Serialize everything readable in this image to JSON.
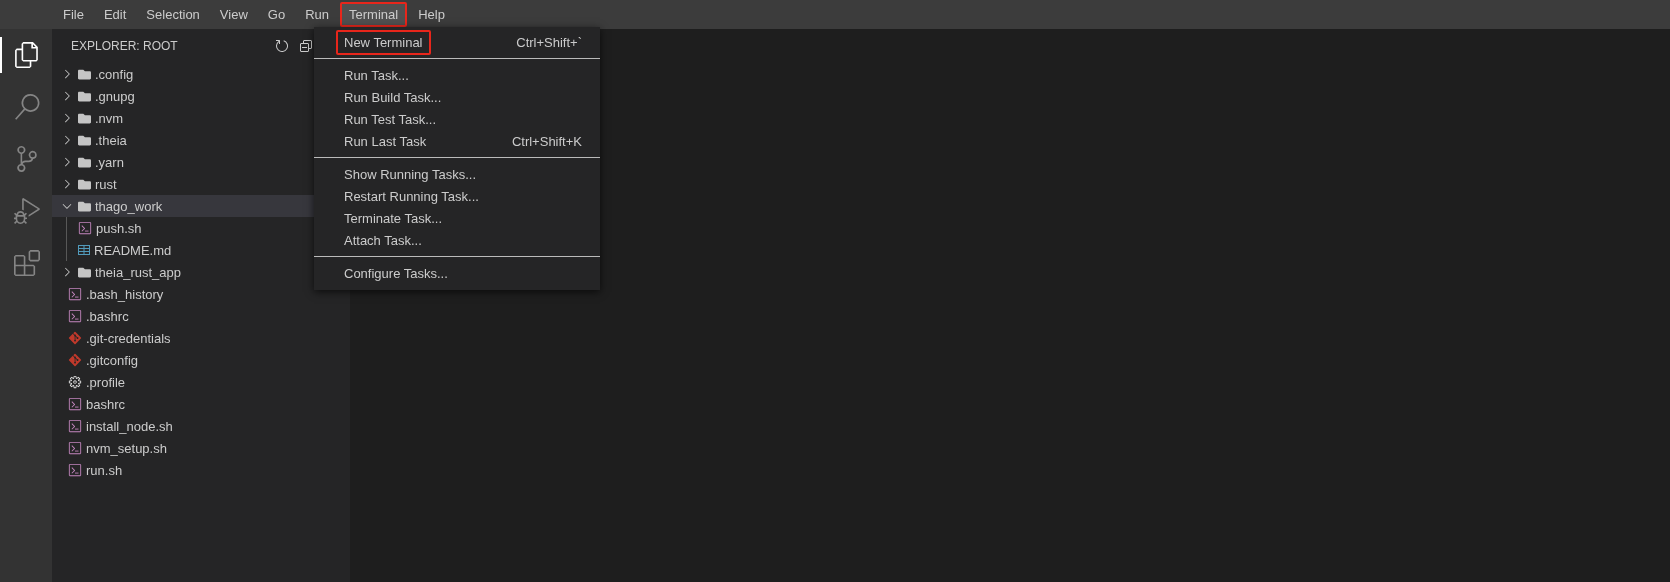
{
  "menu_bar": [
    {
      "label": "File",
      "selected": false,
      "highlighted": false
    },
    {
      "label": "Edit",
      "selected": false,
      "highlighted": false
    },
    {
      "label": "Selection",
      "selected": false,
      "highlighted": false
    },
    {
      "label": "View",
      "selected": false,
      "highlighted": false
    },
    {
      "label": "Go",
      "selected": false,
      "highlighted": false
    },
    {
      "label": "Run",
      "selected": false,
      "highlighted": false
    },
    {
      "label": "Terminal",
      "selected": true,
      "highlighted": true
    },
    {
      "label": "Help",
      "selected": false,
      "highlighted": false
    }
  ],
  "activity_bar": [
    {
      "kind": "files",
      "selected": true
    },
    {
      "kind": "search",
      "selected": false
    },
    {
      "kind": "scm",
      "selected": false
    },
    {
      "kind": "debug",
      "selected": false
    },
    {
      "kind": "extensions",
      "selected": false
    }
  ],
  "sidebar": {
    "title": "EXPLORER: ROOT",
    "items": [
      {
        "kind": "folder",
        "name": ".config",
        "expanded": false,
        "selected": false
      },
      {
        "kind": "folder",
        "name": ".gnupg",
        "expanded": false,
        "selected": false
      },
      {
        "kind": "folder",
        "name": ".nvm",
        "expanded": false,
        "selected": false
      },
      {
        "kind": "folder",
        "name": ".theia",
        "expanded": false,
        "selected": false
      },
      {
        "kind": "folder",
        "name": ".yarn",
        "expanded": false,
        "selected": false
      },
      {
        "kind": "folder",
        "name": "rust",
        "expanded": false,
        "selected": false
      },
      {
        "kind": "folder",
        "name": "thago_work",
        "expanded": true,
        "selected": true,
        "children": [
          {
            "kind": "shell",
            "name": "push.sh",
            "selected": false
          },
          {
            "kind": "markdown",
            "name": "README.md",
            "selected": false
          }
        ]
      },
      {
        "kind": "folder",
        "name": "theia_rust_app",
        "expanded": false,
        "selected": false
      },
      {
        "kind": "shell",
        "name": ".bash_history",
        "selected": false
      },
      {
        "kind": "shell",
        "name": ".bashrc",
        "selected": false
      },
      {
        "kind": "git",
        "name": ".git-credentials",
        "selected": false
      },
      {
        "kind": "git",
        "name": ".gitconfig",
        "selected": false
      },
      {
        "kind": "settings",
        "name": ".profile",
        "selected": false
      },
      {
        "kind": "shell",
        "name": "bashrc",
        "selected": false
      },
      {
        "kind": "shell",
        "name": "install_node.sh",
        "selected": false
      },
      {
        "kind": "shell",
        "name": "nvm_setup.sh",
        "selected": false
      },
      {
        "kind": "shell",
        "name": "run.sh",
        "selected": false
      }
    ]
  },
  "terminal_menu": [
    {
      "kind": "item",
      "label": "New Terminal",
      "shortcut": "Ctrl+Shift+`",
      "highlighted": true
    },
    {
      "kind": "separator"
    },
    {
      "kind": "item",
      "label": "Run Task...",
      "highlighted": false
    },
    {
      "kind": "item",
      "label": "Run Build Task...",
      "highlighted": false
    },
    {
      "kind": "item",
      "label": "Run Test Task...",
      "highlighted": false
    },
    {
      "kind": "item",
      "label": "Run Last Task",
      "shortcut": "Ctrl+Shift+K",
      "highlighted": false
    },
    {
      "kind": "separator"
    },
    {
      "kind": "item",
      "label": "Show Running Tasks...",
      "highlighted": false
    },
    {
      "kind": "item",
      "label": "Restart Running Task...",
      "highlighted": false
    },
    {
      "kind": "item",
      "label": "Terminate Task...",
      "highlighted": false
    },
    {
      "kind": "item",
      "label": "Attach Task...",
      "highlighted": false
    },
    {
      "kind": "separator"
    },
    {
      "kind": "item",
      "label": "Configure Tasks...",
      "highlighted": false
    }
  ]
}
